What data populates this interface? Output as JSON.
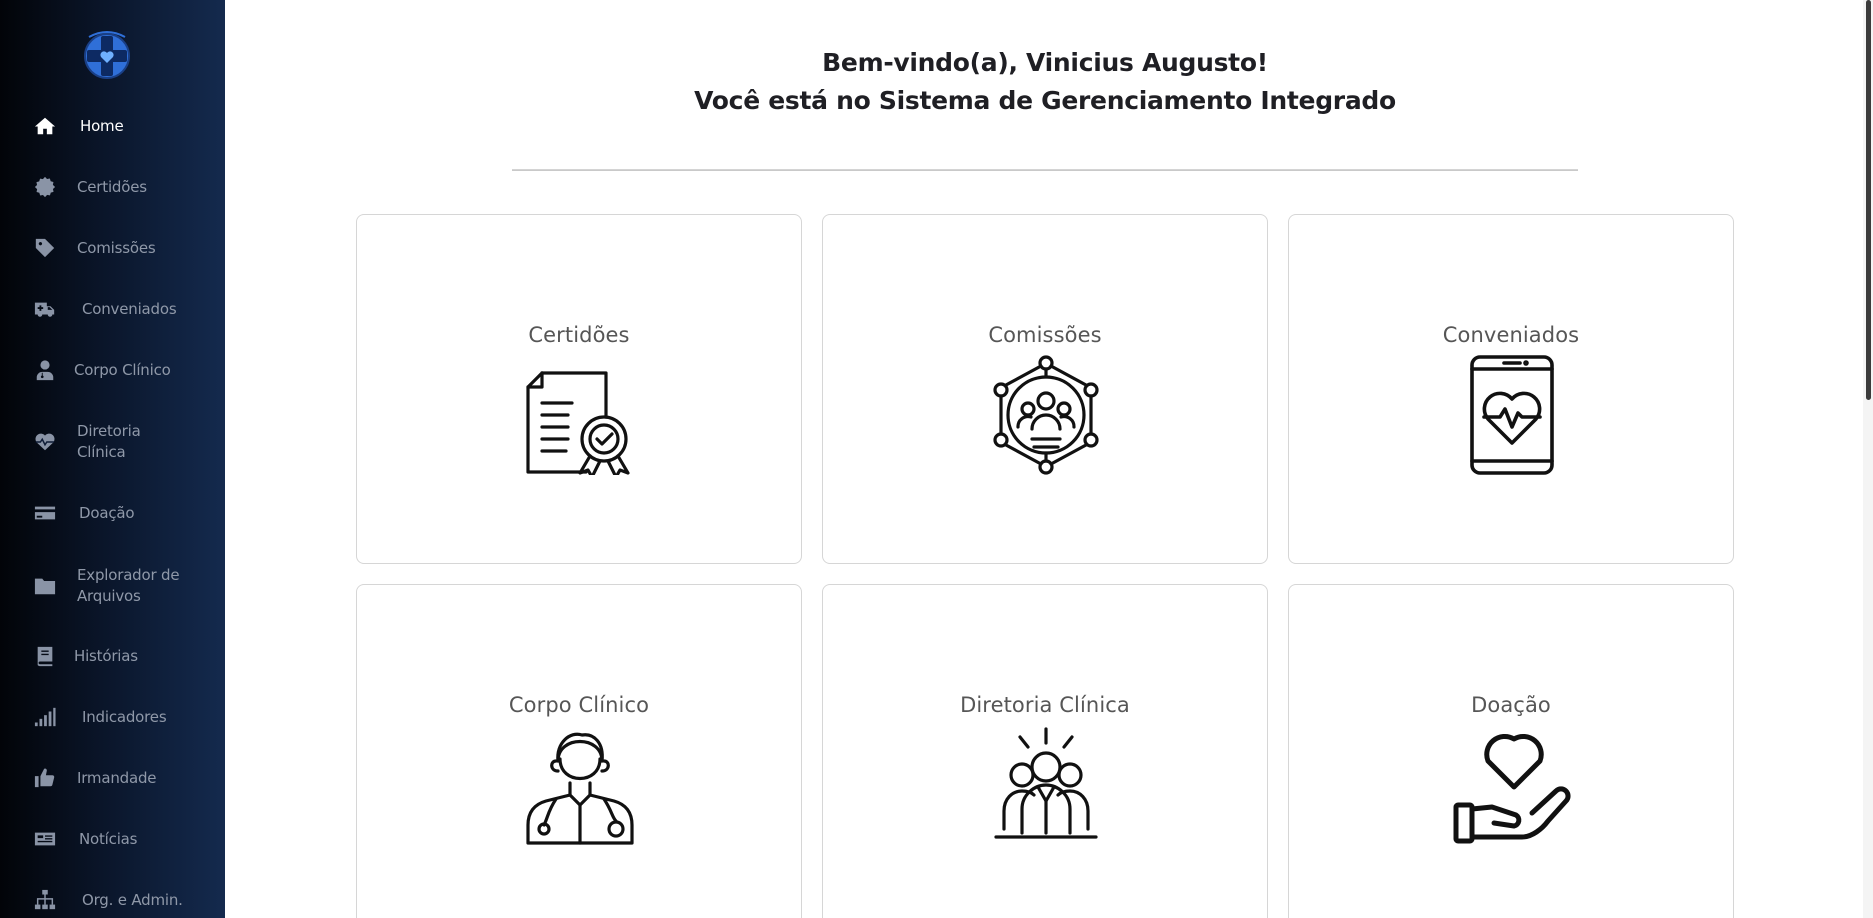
{
  "sidebar": {
    "logo_icon": "hospital-cross-logo",
    "items": [
      {
        "label": "Home",
        "icon": "home-icon",
        "active": true
      },
      {
        "label": "Certidões",
        "icon": "certificate-seal-icon"
      },
      {
        "label": "Comissões",
        "icon": "tag-icon"
      },
      {
        "label": "Conveniados",
        "icon": "ambulance-icon"
      },
      {
        "label": "Corpo Clínico",
        "icon": "doctor-icon"
      },
      {
        "label": "Diretoria",
        "label2": "Clínica",
        "icon": "heartbeat-icon"
      },
      {
        "label": "Doação",
        "icon": "credit-card-icon"
      },
      {
        "label": "Explorador de",
        "label2": "Arquivos",
        "icon": "folder-icon"
      },
      {
        "label": "Histórias",
        "icon": "book-icon"
      },
      {
        "label": "Indicadores",
        "icon": "signal-bars-icon"
      },
      {
        "label": "Irmandade",
        "icon": "thumbs-up-icon"
      },
      {
        "label": "Notícias",
        "icon": "newspaper-icon"
      },
      {
        "label": "Org. e Admin.",
        "icon": "org-chart-icon"
      }
    ]
  },
  "main": {
    "welcome_line1": "Bem-vindo(a), Vinicius Augusto!",
    "welcome_line2": "Você está no Sistema de Gerenciamento Integrado",
    "cards": [
      {
        "title": "Certidões",
        "icon": "certificate-document-icon"
      },
      {
        "title": "Comissões",
        "icon": "network-group-icon"
      },
      {
        "title": "Conveniados",
        "icon": "phone-heart-icon"
      },
      {
        "title": "Corpo Clínico",
        "icon": "doctor-stethoscope-icon"
      },
      {
        "title": "Diretoria Clínica",
        "icon": "team-leaders-icon"
      },
      {
        "title": "Doação",
        "icon": "hand-heart-icon"
      }
    ]
  },
  "colors": {
    "sidebar_dark": "#020408",
    "sidebar_blue": "#142a4e",
    "logo_blue": "#2f6fd8",
    "text_dark": "#1f1f24",
    "card_title": "#565656",
    "nav_inactive": "#8f98a8"
  }
}
